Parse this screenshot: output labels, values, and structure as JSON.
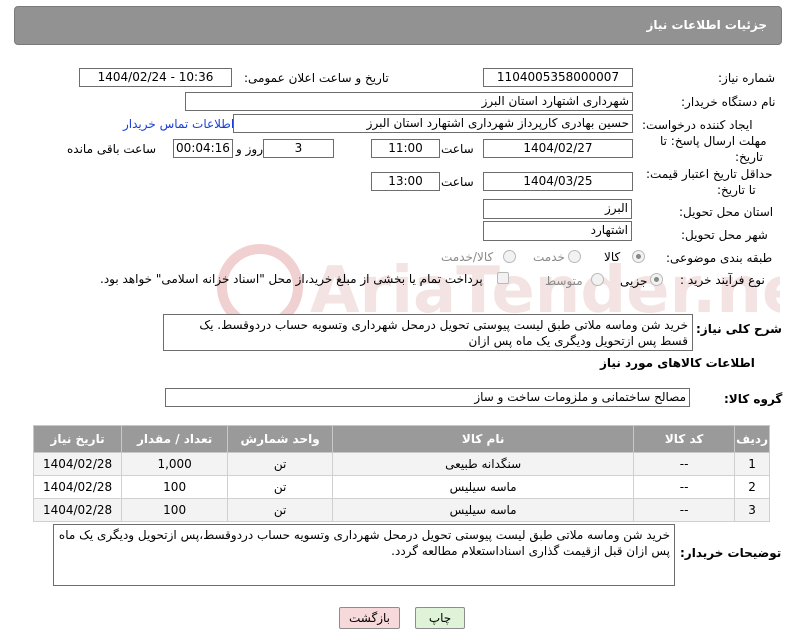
{
  "header": {
    "title": "جزئیات اطلاعات نیاز"
  },
  "fields": {
    "need_number_label": "شماره نیاز:",
    "need_number": "1104005358000007",
    "announce_label": "تاریخ و ساعت اعلان عمومی:",
    "announce_value": "1404/02/24 - 10:36",
    "buyer_org_label": "نام دستگاه خریدار:",
    "buyer_org": "شهرداری اشتهارد استان البرز",
    "creator_label": "ایجاد کننده درخواست:",
    "creator": "حسین بهادری کارپرداز شهرداری اشتهارد استان البرز",
    "contact_link": "اطلاعات تماس خریدار",
    "reply_deadline_label_1": "مهلت ارسال پاسخ: تا",
    "reply_deadline_label_2": "تاریخ:",
    "reply_date": "1404/02/27",
    "time_label": "ساعت",
    "reply_time": "11:00",
    "days_count": "3",
    "days_label": "روز و",
    "remaining_time": "00:04:16",
    "remaining_label": "ساعت باقی مانده",
    "price_validity_label_1": "حداقل تاریخ اعتبار قیمت:",
    "price_validity_label_2": "تا تاریخ:",
    "price_date": "1404/03/25",
    "price_time": "13:00",
    "province_label": "استان محل تحویل:",
    "province": "البرز",
    "city_label": "شهر محل تحویل:",
    "city": "اشتهارد",
    "category_label": "طبقه بندی موضوعی:",
    "category_options": [
      "کالا",
      "خدمت",
      "کالا/خدمت"
    ],
    "process_label": "نوع فرآیند خرید :",
    "process_options": [
      "جزیی",
      "متوسط"
    ],
    "payment_note": "پرداخت تمام یا بخشی از مبلغ خرید،از محل \"اسناد خزانه اسلامی\" خواهد بود.",
    "description_label": "شرح کلی نیاز:",
    "description": "خرید شن وماسه ملاتی طبق لیست پیوستی تحویل درمحل شهرداری وتسویه حساب دردوقسط. یک قسط پس ازتحویل ودیگری یک ماه پس ازان",
    "goods_info_title": "اطلاعات کالاهای مورد نیاز",
    "goods_group_label": "گروه کالا:",
    "goods_group": "مصالح ساختمانی و ملزومات ساخت و ساز"
  },
  "table": {
    "headers": [
      "ردیف",
      "کد کالا",
      "نام کالا",
      "واحد شمارش",
      "تعداد / مقدار",
      "تاریخ نیاز"
    ],
    "rows": [
      [
        "1",
        "--",
        "سنگدانه طبیعی",
        "تن",
        "1,000",
        "1404/02/28"
      ],
      [
        "2",
        "--",
        "ماسه سیلیس",
        "تن",
        "100",
        "1404/02/28"
      ],
      [
        "3",
        "--",
        "ماسه سیلیس",
        "تن",
        "100",
        "1404/02/28"
      ]
    ]
  },
  "buyer_notes": {
    "label": "توضیحات خریدار:",
    "text": "خرید شن وماسه ملاتی طبق لیست پیوستی تحویل درمحل شهرداری وتسویه حساب دردوقسط،پس ازتحویل ودیگری یک ماه پس ازان قبل ازقیمت گذاری اسناداستعلام مطالعه گردد."
  },
  "buttons": {
    "print": "چاپ",
    "back": "بازگشت"
  },
  "colors": {
    "header_bg": "#929292",
    "link": "#1a3fd6",
    "back_btn_bg": "#f7d9dc",
    "print_btn_bg": "#dff3d8"
  }
}
